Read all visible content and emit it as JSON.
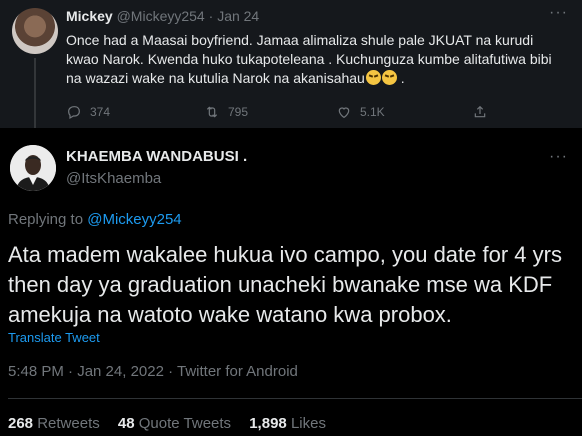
{
  "parent_tweet": {
    "display_name": "Mickey",
    "handle": "@Mickeyy254",
    "date": "Jan 24",
    "text": "Once had a Maasai boyfriend. Jamaa alimaliza shule pale JKUAT na kurudi kwao Narok. Kwenda huko tukapoteleana . Kuchunguza kumbe alitafutiwa bibi na wazazi wake na kutulia Narok na akanisahau",
    "text_suffix": ".",
    "emoji_icons": [
      "tired-face-icon",
      "tired-face-icon"
    ],
    "replies": "374",
    "retweets": "795",
    "likes": "5.1K"
  },
  "main_tweet": {
    "display_name": "KHAEMBA WANDABUSI .",
    "handle": "@ItsKhaemba",
    "replying_prefix": "Replying to ",
    "replying_to": "@Mickeyy254",
    "text": "Ata madem wakalee hukua ivo campo, you date for 4 yrs then day ya graduation unacheki bwanake mse wa KDF amekuja na watoto wake watano kwa probox.",
    "translate_label": "Translate Tweet",
    "meta": "5:48 PM · Jan 24, 2022 · Twitter for Android",
    "retweets_count": "268",
    "retweets_label": "Retweets",
    "quote_count": "48",
    "quote_label": "Quote Tweets",
    "likes_count": "1,898",
    "likes_label": "Likes"
  },
  "more_icon": "more-horizontal-icon",
  "colors": {
    "accent": "#1d9bf0",
    "muted": "#71767b",
    "parent_bg": "#15181c",
    "bg": "#000000"
  }
}
